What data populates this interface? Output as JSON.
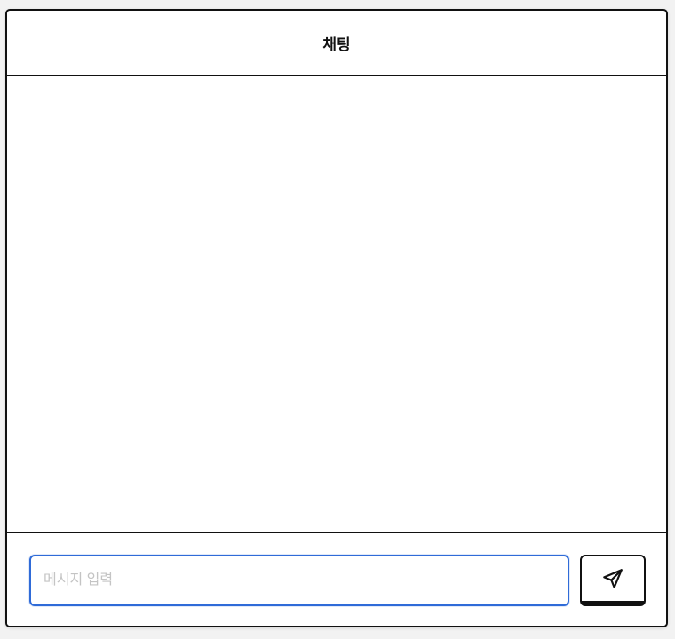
{
  "header": {
    "title": "채팅"
  },
  "messages": [],
  "composer": {
    "placeholder": "메시지 입력",
    "value": "",
    "send_icon": "send-paper-plane-icon"
  },
  "colors": {
    "border": "#111111",
    "input_focus_border": "#2f6bd8",
    "background": "#ffffff"
  }
}
